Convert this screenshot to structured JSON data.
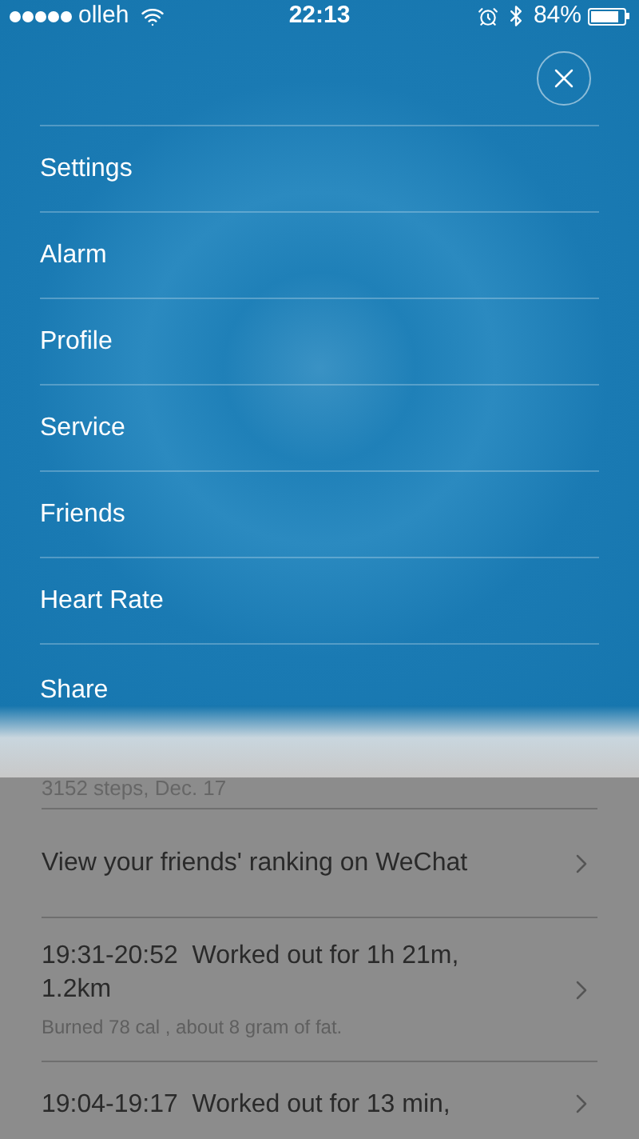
{
  "status_bar": {
    "carrier": "olleh",
    "time": "22:13",
    "battery": "84%"
  },
  "menu": {
    "items": [
      {
        "label": "Settings"
      },
      {
        "label": "Alarm"
      },
      {
        "label": "Profile"
      },
      {
        "label": "Service"
      },
      {
        "label": "Friends"
      },
      {
        "label": "Heart Rate"
      },
      {
        "label": "Share"
      }
    ]
  },
  "background_list": {
    "steps_caption": "3152 steps, Dec. 17",
    "rows": [
      {
        "title": "View your friends' ranking on WeChat"
      },
      {
        "title": "19:31-20:52  Worked out for 1h 21m, 1.2km",
        "subtitle": "Burned 78 cal , about 8 gram of fat."
      },
      {
        "title": "19:04-19:17  Worked out for 13 min,"
      }
    ]
  }
}
